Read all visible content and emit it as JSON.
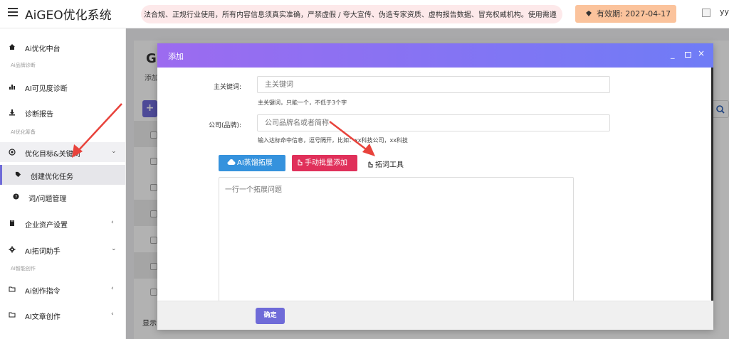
{
  "app": {
    "title": "AiGEO优化系统",
    "notice": "法合规、正规行业使用，所有内容信息须真实准确，严禁虚假 / 夸大宣传、伪造专家资质、虚构报告数据、冒充权威机构。使用需遵",
    "validity": "有效期: 2027-04-17",
    "username": "yy"
  },
  "sidebar": {
    "items": [
      {
        "label": "Ai优化中台",
        "icon": "home-icon"
      },
      {
        "section": "Ai品牌诊断"
      },
      {
        "label": "AI可见度诊断",
        "icon": "bar-chart-icon"
      },
      {
        "label": "诊断报告",
        "icon": "download-icon"
      },
      {
        "section": "AI优化筹备"
      },
      {
        "label": "优化目标&关键词",
        "icon": "target-icon",
        "chevron": "⌄"
      },
      {
        "label": "创建优化任务",
        "icon": "tag-icon"
      },
      {
        "label": "词/问题管理",
        "icon": "question-icon"
      },
      {
        "label": "企业资产设置",
        "icon": "book-icon",
        "chevron": "‹"
      },
      {
        "label": "AI拓词助手",
        "icon": "gear-icon",
        "chevron": "⌄"
      },
      {
        "section": "AI智能创作"
      },
      {
        "label": "Ai创作指令",
        "icon": "folder-icon",
        "chevron": "‹"
      },
      {
        "label": "AI文章创作",
        "icon": "folder-icon",
        "chevron": "‹"
      }
    ]
  },
  "page": {
    "heading": "GI",
    "subtitle": "添加",
    "add_button": "+",
    "footer_text": "显示"
  },
  "dialog": {
    "title": "添加",
    "controls": {
      "minimize": "_",
      "close": "×"
    },
    "main_keyword": {
      "label": "主关键词:",
      "placeholder": "主关键词",
      "hint": "主关键词，只能一个，不低于3个字"
    },
    "company": {
      "label": "公司(品牌):",
      "placeholder": "公司品牌名或者简称",
      "hint": "输入达标命中信息，逗号隔开，比如：xx科技公司，xx科技"
    },
    "ai_expand_label": "AI蒸馏拓展",
    "manual_add_label": "手动批量添加",
    "tool_label": "拓词工具",
    "textarea_placeholder": "一行一个拓展问题",
    "confirm_label": "确定"
  },
  "colors": {
    "primary": "#6f6bd8",
    "blue": "#3592dd",
    "red": "#e0305a",
    "notice_bg": "#fde9ea",
    "validity_bg": "#fbc39c",
    "annotation_arrow": "#e8433c"
  }
}
